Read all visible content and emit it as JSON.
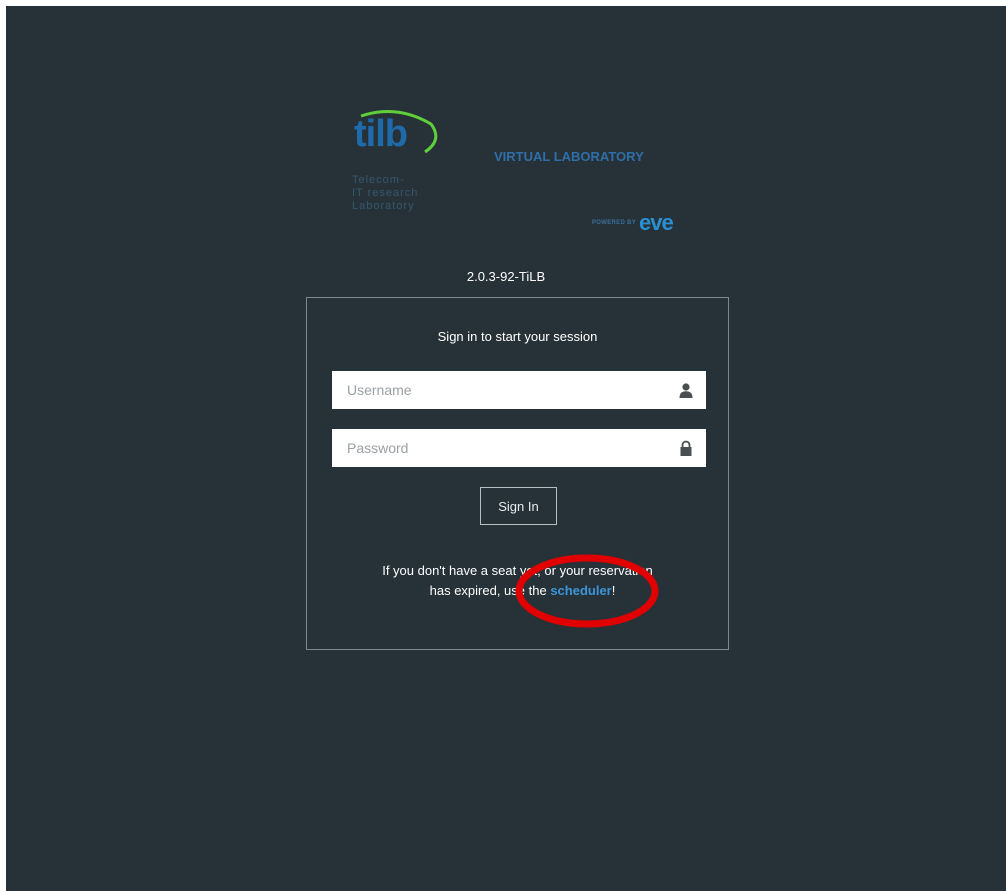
{
  "brand": {
    "logo_text": "tilb",
    "subtitle": "Telecom-\nIT research\nLaboratory",
    "tagline": "VIRTUAL LABORATORY",
    "powered_by": "POWERED BY",
    "eve_logo": "eve",
    "accent_color": "#1f6aa8",
    "green_arc_color": "#5fd03a"
  },
  "version": "2.0.3-92-TiLB",
  "login": {
    "title": "Sign in to start your session",
    "username_placeholder": "Username",
    "username_value": "",
    "username_icon": "user-icon",
    "password_placeholder": "Password",
    "password_value": "",
    "password_icon": "lock-icon",
    "signin_label": "Sign In"
  },
  "help": {
    "line1": "If you don't have a seat yet, or your reservation",
    "line2_prefix": "has expired, use the ",
    "link_label": "scheduler",
    "line2_suffix": "!"
  },
  "colors": {
    "background": "#263238",
    "link": "#3c95d8",
    "annotation": "#e00000"
  }
}
